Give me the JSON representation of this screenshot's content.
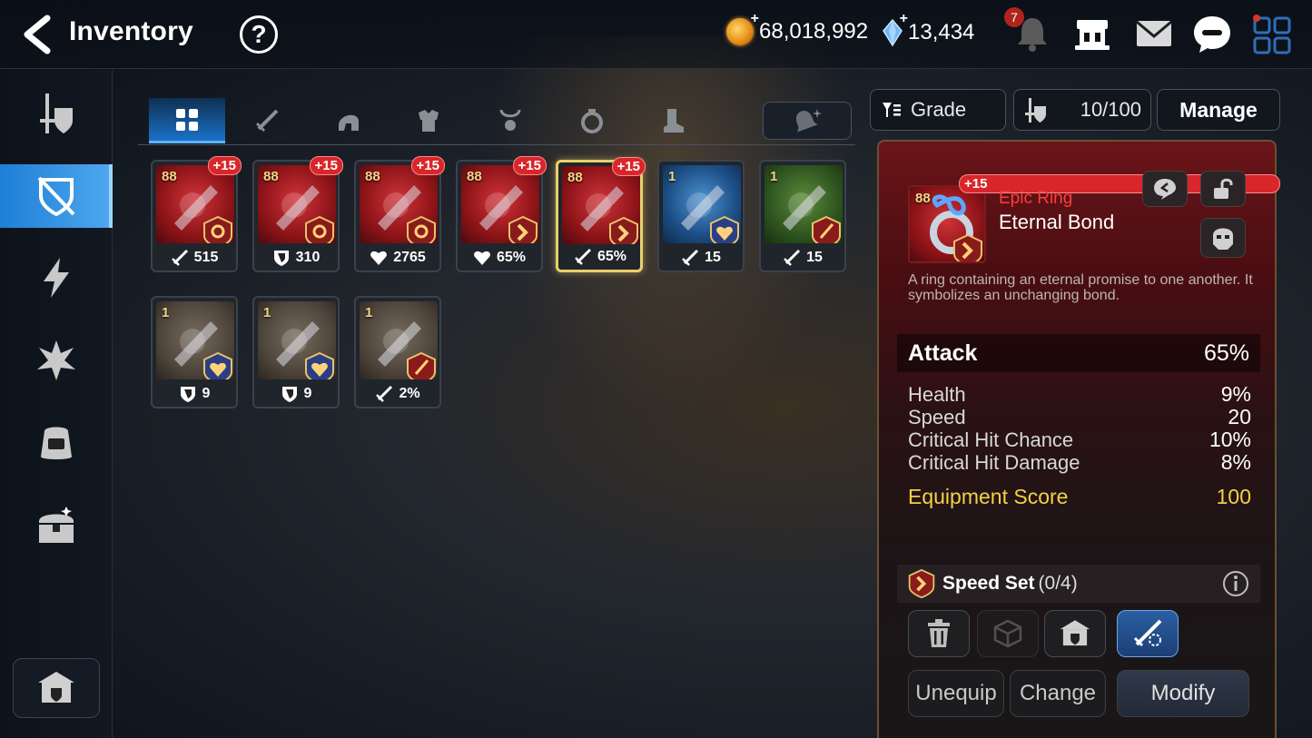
{
  "header": {
    "title": "Inventory",
    "help_label": "?",
    "gold": "68,018,992",
    "crystals": "13,434",
    "notification_count": "7"
  },
  "sidebar": {
    "items": [
      {
        "name": "hero-equipment",
        "icon": "sword-shield-icon",
        "active": false
      },
      {
        "name": "equipment",
        "icon": "crossed-shield-icon",
        "active": true
      },
      {
        "name": "artifacts",
        "icon": "lightning-icon",
        "active": false
      },
      {
        "name": "materials",
        "icon": "crystal-burst-icon",
        "active": false
      },
      {
        "name": "bag",
        "icon": "backpack-icon",
        "active": false
      },
      {
        "name": "chests",
        "icon": "chest-icon",
        "active": false
      }
    ],
    "bottom_icon": "shop-icon"
  },
  "tabs": {
    "items": [
      {
        "name": "all",
        "icon": "grid-icon",
        "active": true
      },
      {
        "name": "weapon",
        "icon": "sword-icon"
      },
      {
        "name": "helmet",
        "icon": "helmet-icon"
      },
      {
        "name": "armor",
        "icon": "armor-icon"
      },
      {
        "name": "necklace",
        "icon": "necklace-icon"
      },
      {
        "name": "ring",
        "icon": "ring-icon"
      },
      {
        "name": "boots",
        "icon": "boots-icon"
      }
    ],
    "extra_button_icon": "bell-sparkle-icon"
  },
  "items": [
    {
      "level": "88",
      "enhance": "+15",
      "stat_icon": "attack-icon",
      "stat": "515",
      "rarity_color": "red",
      "set": "sun"
    },
    {
      "level": "88",
      "enhance": "+15",
      "stat_icon": "defense-icon",
      "stat": "310",
      "rarity_color": "red",
      "set": "sun"
    },
    {
      "level": "88",
      "enhance": "+15",
      "stat_icon": "health-icon",
      "stat": "2765",
      "rarity_color": "red",
      "set": "sun"
    },
    {
      "level": "88",
      "enhance": "+15",
      "stat_icon": "health-icon",
      "stat": "65%",
      "rarity_color": "red",
      "set": "speed"
    },
    {
      "level": "88",
      "enhance": "+15",
      "stat_icon": "attack-icon",
      "stat": "65%",
      "rarity_color": "red",
      "set": "speed",
      "selected": true
    },
    {
      "level": "1",
      "enhance": "",
      "stat_icon": "attack-icon",
      "stat": "15",
      "rarity_color": "blue",
      "set": "heart"
    },
    {
      "level": "1",
      "enhance": "",
      "stat_icon": "attack-icon",
      "stat": "15",
      "rarity_color": "green",
      "set": "attack"
    },
    {
      "level": "1",
      "enhance": "",
      "stat_icon": "defense-icon",
      "stat": "9",
      "rarity_color": "brown",
      "set": "heart"
    },
    {
      "level": "1",
      "enhance": "",
      "stat_icon": "defense-icon",
      "stat": "9",
      "rarity_color": "brown",
      "set": "heart"
    },
    {
      "level": "1",
      "enhance": "",
      "stat_icon": "attack-icon",
      "stat": "2%",
      "rarity_color": "brown",
      "set": "attack"
    }
  ],
  "right_panel": {
    "sort_label": "Grade",
    "capacity": "10/100",
    "manage_label": "Manage",
    "selected": {
      "level": "88",
      "enhance": "+15",
      "rarity": "Epic Ring",
      "name": "Eternal Bond",
      "description": "A ring containing an eternal promise to one another. It symbolizes an unchanging bond.",
      "main_stat": {
        "label": "Attack",
        "value": "65%"
      },
      "sub_stats": [
        {
          "label": "Health",
          "value": "9%"
        },
        {
          "label": "Speed",
          "value": "20"
        },
        {
          "label": "Critical Hit Chance",
          "value": "10%"
        },
        {
          "label": "Critical Hit Damage",
          "value": "8%"
        }
      ],
      "score": {
        "label": "Equipment Score",
        "value": "100"
      },
      "set": {
        "name": "Speed Set",
        "count": "(0/4)"
      }
    },
    "buttons": {
      "unequip": "Unequip",
      "change": "Change",
      "modify": "Modify"
    }
  }
}
